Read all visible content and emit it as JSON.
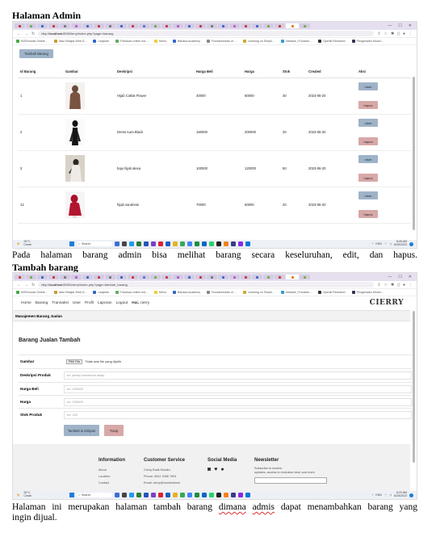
{
  "section1": {
    "heading": "Halaman Admin",
    "caption": "Pada halaman barang admin bisa melihat barang secara keseluruhan, edit, dan hapus."
  },
  "section2": {
    "heading": "Tambah barang",
    "caption_before": "Halaman ini merupakan halaman tambah barang ",
    "caption_w1": "dimana",
    "caption_space": " ",
    "caption_w2": "admis",
    "caption_after": " dapat menambahkan barang yang",
    "caption_line2": "ingin dijual."
  },
  "browser": {
    "url1_host": "localhost",
    "url1_path": ":8000/ierry/index.php?page=barang",
    "url2_host": "localhost",
    "url2_path": ":8000/cierry/index.php?page=tambah_barang",
    "url_prefix": "http://",
    "window_controls": [
      "—",
      "☐",
      "✕"
    ],
    "bookmarks": [
      "W3Schools Online...",
      "Jalur Belajar Web D...",
      "Lanjutan",
      "Panduan online ind...",
      "Menu",
      "Bahasa Academy",
      "Fundamentals of ...",
      "Learning on Simpli...",
      "Jetstack | Fundam...",
      "Openlit Research",
      "Pengenalan Modul..."
    ]
  },
  "taskbar": {
    "temp": "26°C",
    "weather": "Cerah",
    "search_label": "Search",
    "lang": "ENG",
    "time1": "8:25 AM",
    "date1": "6/25/2023",
    "time2": "8:23 AM",
    "date2": "6/25/2023"
  },
  "admin_page": {
    "add_button": "Tambah Barang",
    "columns": [
      "Id Barang",
      "Gambar",
      "Deskripsi",
      "Harga Beli",
      "Harga",
      "Stok",
      "Created",
      "Aksi"
    ],
    "rows": [
      {
        "id": "1",
        "desc": "Hijab Coklat Flower",
        "buy": "40000",
        "price": "60000",
        "stock": "30",
        "created": "2023-06-20"
      },
      {
        "id": "2",
        "desc": "Dress Aura Black",
        "buy": "150000",
        "price": "200000",
        "stock": "20",
        "created": "2023-06-20"
      },
      {
        "id": "3",
        "desc": "baju hijab alexa",
        "buy": "100000",
        "price": "120000",
        "stock": "50",
        "created": "2023-06-20"
      },
      {
        "id": "12",
        "desc": "hijab sandress",
        "buy": "70000",
        "price": "50000",
        "stock": "20",
        "created": "2023-06-20"
      }
    ],
    "edit_label": "ubah",
    "delete_label": "hapus"
  },
  "add_page": {
    "nav": [
      "Home",
      "Barang",
      "Transaksi",
      "User",
      "Profil",
      "Laporan",
      "Logout"
    ],
    "greeting_bold": "Hai,",
    "greeting_name": "cierry",
    "logo": "CIERRY",
    "subheader": "Manajemen Barang Jualan",
    "form_title": "Barang Jualan Tambah",
    "fields": [
      {
        "label": "Gambar",
        "file_button": "Pilih File",
        "file_note": "Tidak ada file yang dipilih"
      },
      {
        "label": "Deskripsi Produk",
        "placeholder": "ex: jersey barcelona away"
      },
      {
        "label": "Harga Beli",
        "placeholder": "ex: 100000"
      },
      {
        "label": "Harga",
        "placeholder": "ex: 130000"
      },
      {
        "label": "Stok Produk",
        "placeholder": "ex: 100"
      }
    ],
    "save_button": "Tambah & Simpan",
    "close_button": "Tutup",
    "footer": {
      "info_title": "Information",
      "info_links": [
        "About",
        "Location",
        "Contact"
      ],
      "cs_title": "Customer Service",
      "cs_lines": [
        "Cierry Butik Muslim",
        "Phone: 0812 3456 7891",
        "Email: cierry@muslimstore"
      ],
      "social_title": "Social Media",
      "news_title": "Newsletter",
      "news_text1": "Subscribe to receive",
      "news_text2": "updates, access to exclusive deal, and more."
    }
  },
  "colors": {
    "btn_blue": "#9fb3c8",
    "btn_red": "#d7a8a8",
    "tab_bg": "#e6dff0"
  }
}
